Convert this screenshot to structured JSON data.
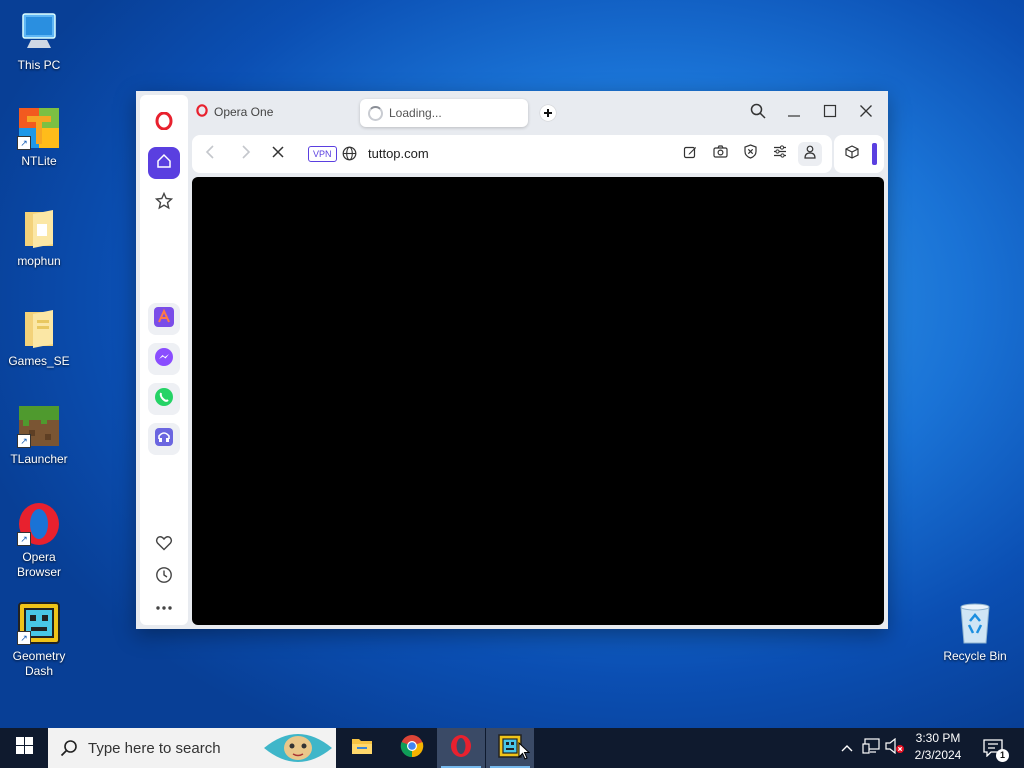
{
  "desktop": {
    "icons": [
      {
        "label": "This PC"
      },
      {
        "label": "NTLite"
      },
      {
        "label": "mophun"
      },
      {
        "label": "Games_SE"
      },
      {
        "label": "TLauncher"
      },
      {
        "label": "Opera Browser"
      },
      {
        "label": "Geometry Dash"
      },
      {
        "label": "Recycle Bin"
      }
    ]
  },
  "browser": {
    "tabs": [
      {
        "title": "Opera One"
      },
      {
        "title": "Loading..."
      }
    ],
    "new_tab_icon": "plus-icon",
    "address": {
      "vpn_badge": "VPN",
      "url": "tuttop.com"
    },
    "sidebar": {
      "items": [
        "home-icon",
        "star-icon",
        "aria-icon",
        "messenger-icon",
        "whatsapp-icon",
        "music-player-icon",
        "heart-icon",
        "history-icon",
        "more-icon"
      ]
    },
    "colors": {
      "accent": "#5a3fe0",
      "opera_red": "#e8212e",
      "content_bg": "#000000"
    }
  },
  "taskbar": {
    "search_placeholder": "Type here to search",
    "apps": [
      "file-explorer-icon",
      "chrome-icon",
      "opera-icon",
      "geometry-dash-icon"
    ],
    "clock": {
      "time": "3:30 PM",
      "date": "2/3/2024"
    },
    "notification_count": "1"
  }
}
